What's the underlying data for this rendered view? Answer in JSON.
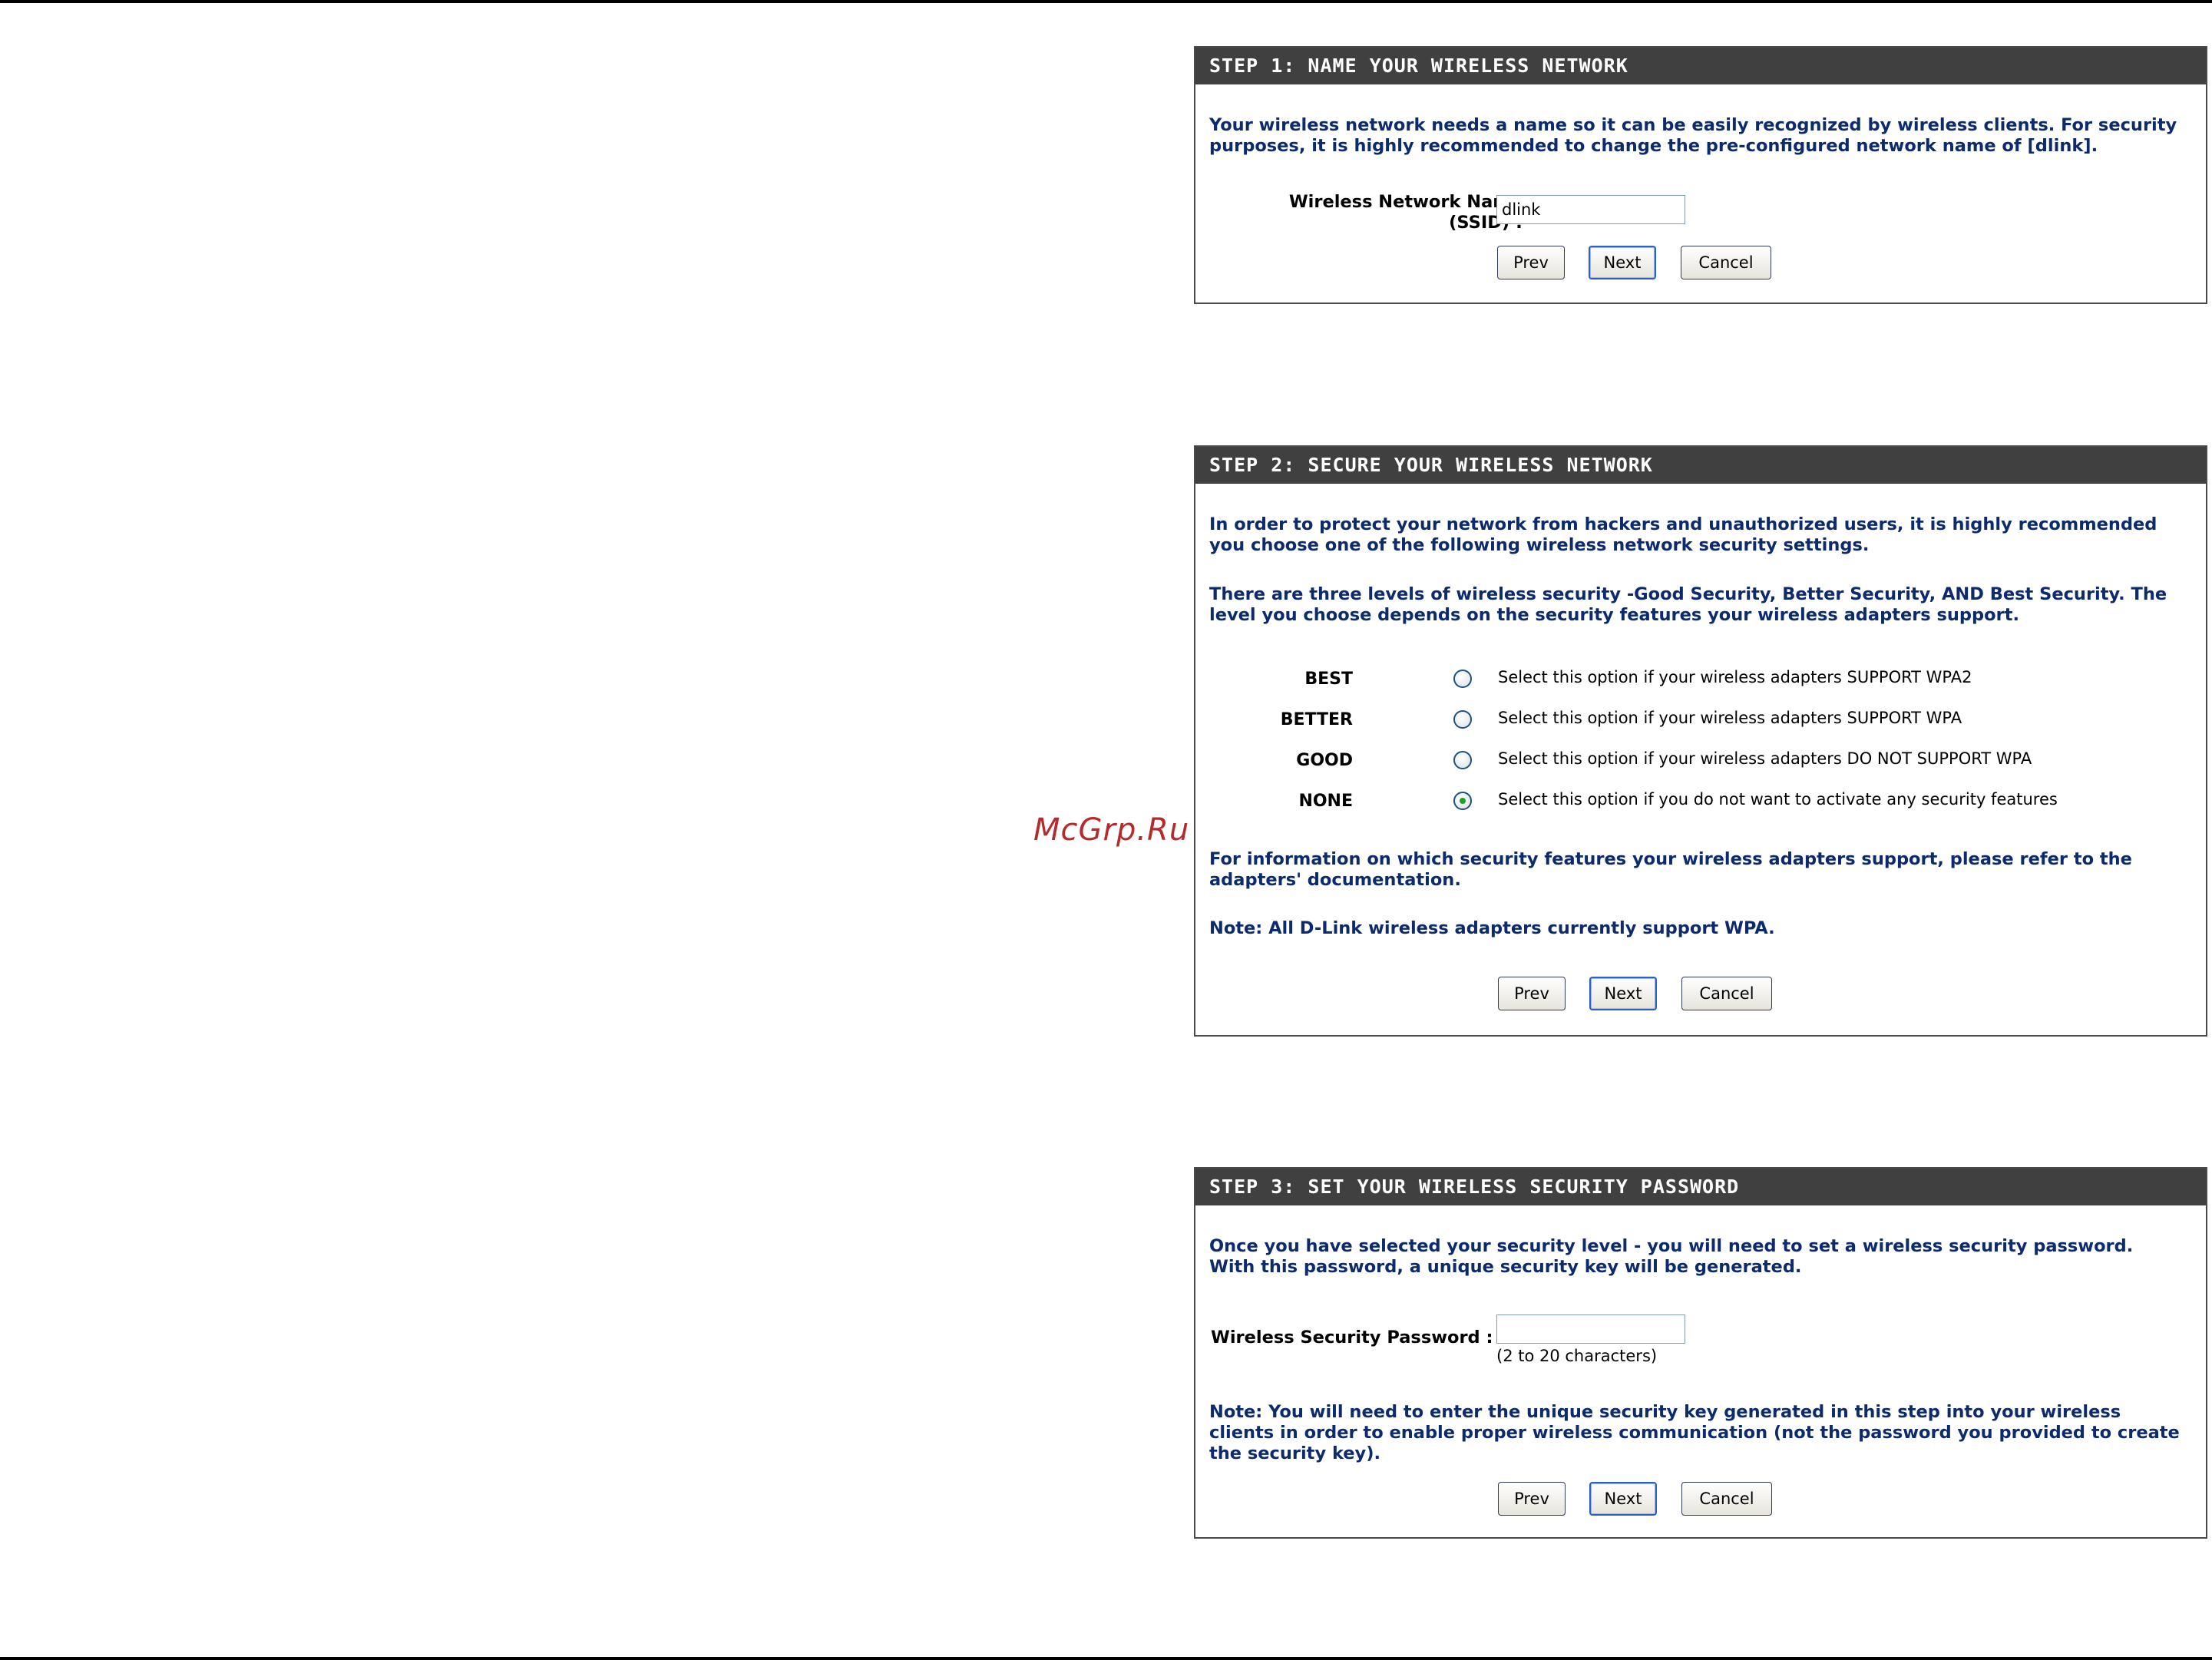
{
  "watermark": "McGrp.Ru",
  "buttons": {
    "prev": "Prev",
    "next": "Next",
    "cancel": "Cancel"
  },
  "step1": {
    "title": "STEP 1: NAME YOUR WIRELESS NETWORK",
    "description": "Your wireless network needs a name so it can be easily recognized by wireless clients. For security purposes, it is highly recommended to change the pre-configured network name of [dlink].",
    "ssid_label_line1": "Wireless Network Name",
    "ssid_label_line2": "(SSID) :",
    "ssid_value": "dlink"
  },
  "step2": {
    "title": "STEP 2: SECURE YOUR WIRELESS NETWORK",
    "intro1": "In order to protect your network from hackers and unauthorized users, it is highly recommended you choose one of the following wireless network security settings.",
    "intro2": "There are three levels of wireless security -Good Security, Better Security, AND Best Security. The level you choose depends on the security features your wireless adapters support.",
    "options": [
      {
        "label": "BEST",
        "description": "Select this option if your wireless adapters SUPPORT WPA2",
        "selected": false
      },
      {
        "label": "BETTER",
        "description": "Select this option if your wireless adapters SUPPORT WPA",
        "selected": false
      },
      {
        "label": "GOOD",
        "description": "Select this option if your wireless adapters DO NOT SUPPORT WPA",
        "selected": false
      },
      {
        "label": "NONE",
        "description": "Select this option if you do not want to activate any security features",
        "selected": true
      }
    ],
    "info": "For information on which security features your wireless adapters support, please refer to the adapters' documentation.",
    "note": "Note: All D-Link wireless adapters currently support WPA."
  },
  "step3": {
    "title": "STEP 3: SET YOUR WIRELESS SECURITY PASSWORD",
    "description": "Once you have selected your security level - you will need to set a wireless security password. With this password, a unique security key will be generated.",
    "password_label": "Wireless Security Password :",
    "password_value": "",
    "password_hint": "(2 to 20 characters)",
    "note": "Note: You will need to enter the unique security key generated in this step into your wireless clients in order to enable proper wireless communication (not the password you provided to create the security key)."
  }
}
